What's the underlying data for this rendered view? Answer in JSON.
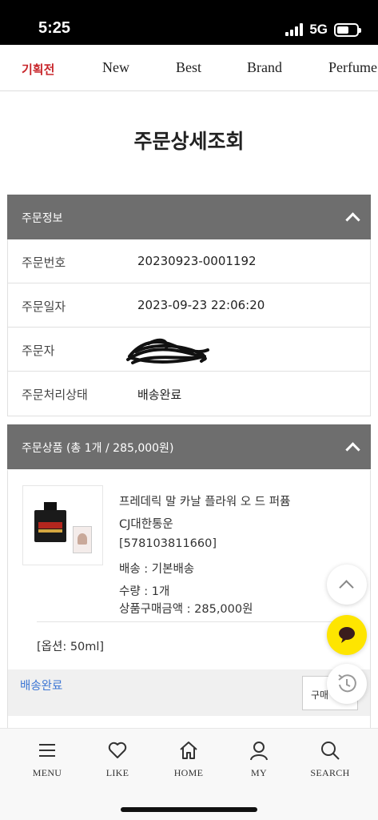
{
  "status_bar": {
    "time": "5:25",
    "network": "5G"
  },
  "top_nav": {
    "items": [
      "기획전",
      "New",
      "Best",
      "Brand",
      "Perfume"
    ],
    "active_index": 0,
    "active_color": "#c8262b"
  },
  "page_title": "주문상세조회",
  "order_info": {
    "header": "주문정보",
    "rows": [
      {
        "label": "주문번호",
        "value": "20230923-0001192"
      },
      {
        "label": "주문일자",
        "value": "2023-09-23 22:06:20"
      },
      {
        "label": "주문자",
        "value": ""
      },
      {
        "label": "주문처리상태",
        "value": "배송완료"
      }
    ]
  },
  "products": {
    "header": "주문상품 (총 1개 / 285,000원)",
    "item": {
      "name": "프레데릭 말 카날 플라워 오 드 퍼퓸",
      "carrier": "CJ대한통운",
      "tracking": "[578103811660]",
      "shipping": "배송 : 기본배송",
      "quantity": "수량 : 1개",
      "price": "상품구매금액 : 285,000원",
      "option": "[옵션: 50ml]",
      "status": "배송완료",
      "buy_button": "구매"
    }
  },
  "colors": {
    "section_header_bg": "#6e6e6e",
    "status_link": "#3e77d4",
    "chat_button": "#fee500"
  },
  "floating": {
    "icons": [
      "chevron-up-icon",
      "chat-bubble-icon",
      "recent-clock-icon"
    ]
  },
  "bottom_nav": {
    "items": [
      {
        "label": "MENU",
        "icon": "menu-icon"
      },
      {
        "label": "LIKE",
        "icon": "heart-icon"
      },
      {
        "label": "HOME",
        "icon": "home-icon"
      },
      {
        "label": "MY",
        "icon": "user-icon"
      },
      {
        "label": "SEARCH",
        "icon": "search-icon"
      }
    ]
  }
}
